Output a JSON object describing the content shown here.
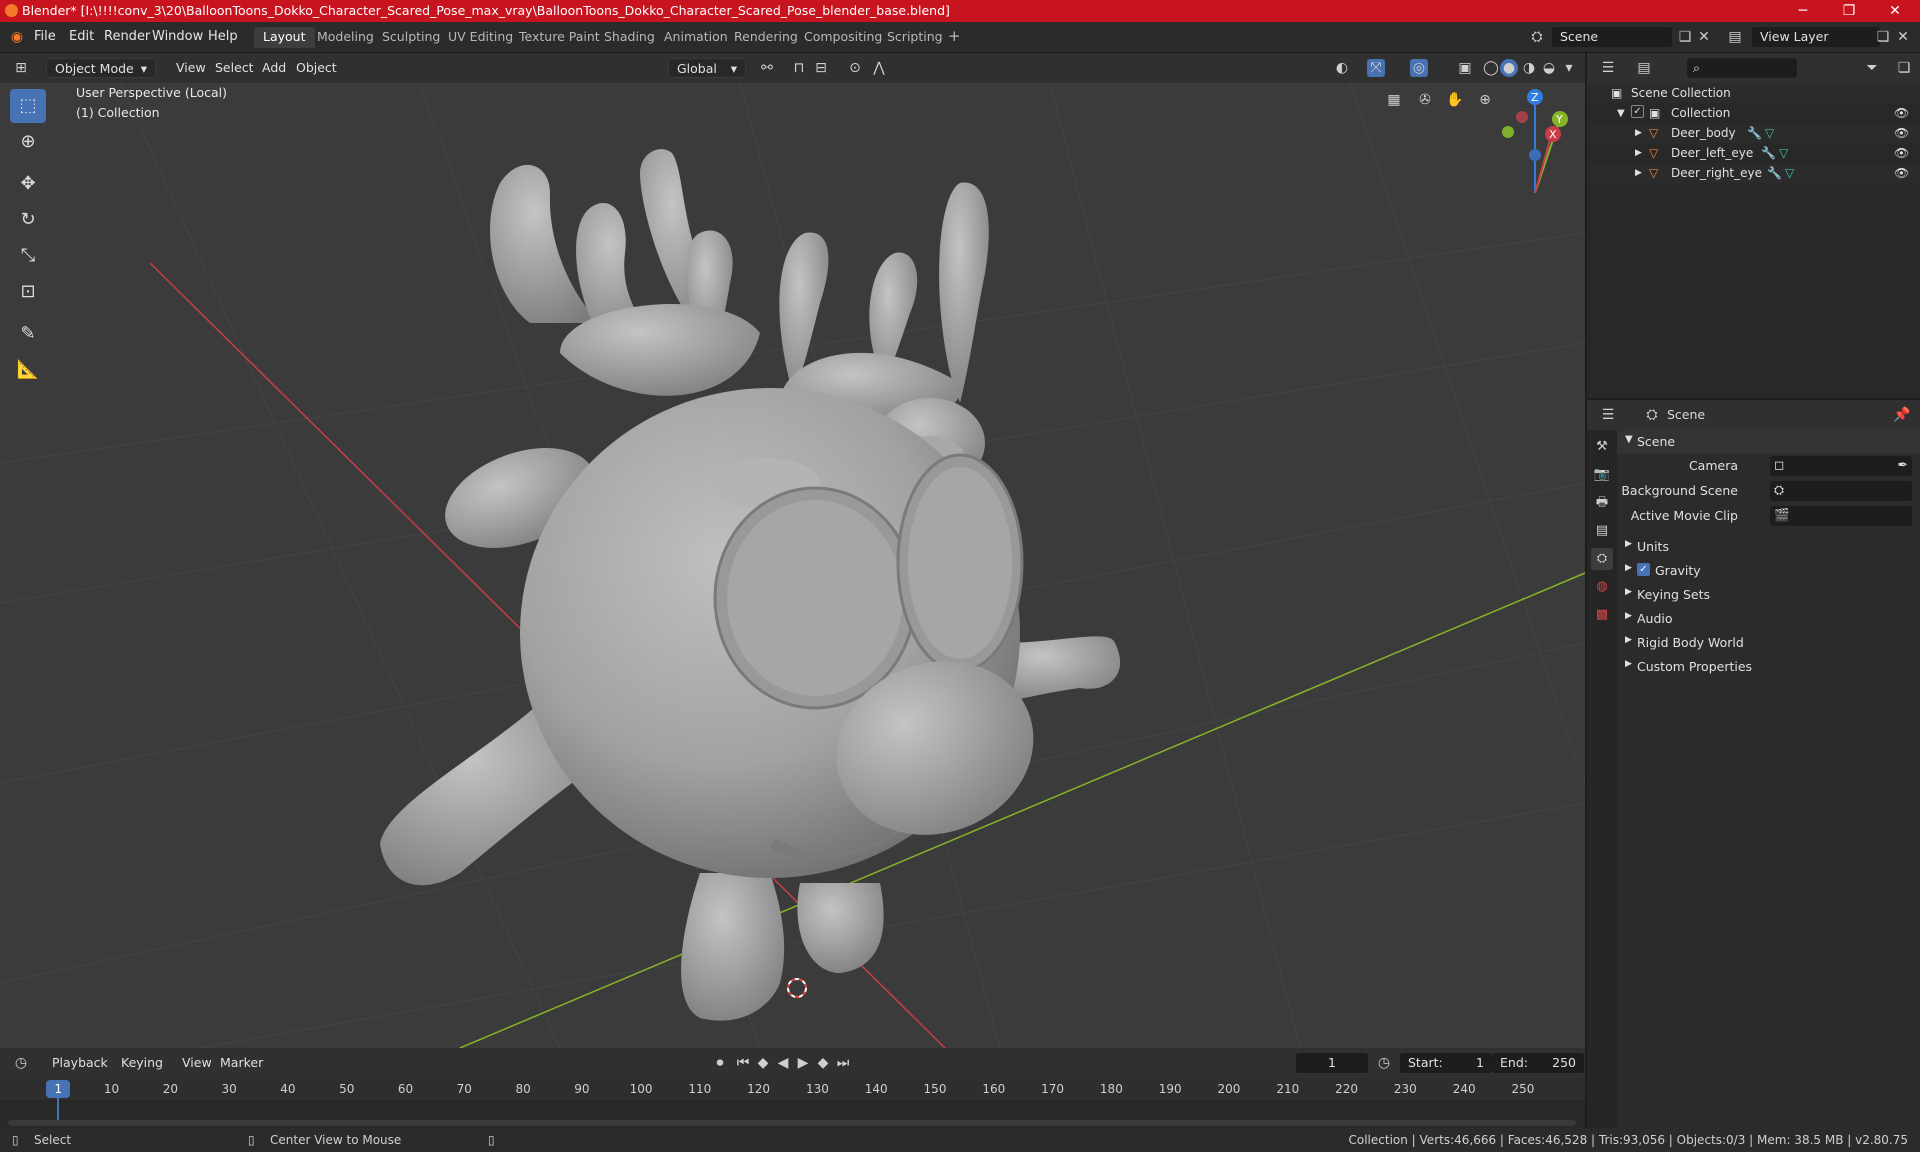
{
  "window": {
    "title": "Blender* [I:\\!!!!conv_3\\20\\BalloonToons_Dokko_Character_Scared_Pose_max_vray\\BalloonToons_Dokko_Character_Scared_Pose_blender_base.blend]",
    "minimize": "─",
    "maximize": "❐",
    "close": "✕"
  },
  "menu": {
    "items": [
      "File",
      "Edit",
      "Render",
      "Window",
      "Help"
    ]
  },
  "workspaces": [
    "Layout",
    "Modeling",
    "Sculpting",
    "UV Editing",
    "Texture Paint",
    "Shading",
    "Animation",
    "Rendering",
    "Compositing",
    "Scripting"
  ],
  "workspace_add": "+",
  "scene_field": "Scene",
  "view_layer_field": "View Layer",
  "viewport_header": {
    "mode": "Object Mode",
    "menus": [
      "View",
      "Select",
      "Add",
      "Object"
    ],
    "orientation": "Global"
  },
  "viewport": {
    "perspective": "User Perspective (Local)",
    "collection": "(1) Collection",
    "gizmo": {
      "z": "Z",
      "y": "Y",
      "x": "X"
    }
  },
  "outliner": {
    "root": "Scene Collection",
    "collection": "Collection",
    "objects": [
      "Deer_body",
      "Deer_left_eye",
      "Deer_right_eye"
    ]
  },
  "properties": {
    "header": "Scene",
    "section": "Scene",
    "fields": [
      {
        "label": "Camera",
        "value": ""
      },
      {
        "label": "Background Scene",
        "value": ""
      },
      {
        "label": "Active Movie Clip",
        "value": ""
      }
    ],
    "panels": [
      "Units",
      "Gravity",
      "Keying Sets",
      "Audio",
      "Rigid Body World",
      "Custom Properties"
    ]
  },
  "timeline": {
    "menus": [
      "Playback",
      "Keying",
      "View",
      "Marker"
    ],
    "current_frame": "1",
    "start_label": "Start:",
    "start": "1",
    "end_label": "End:",
    "end": "250",
    "ticks": [
      "1",
      "10",
      "20",
      "30",
      "40",
      "50",
      "60",
      "70",
      "80",
      "90",
      "100",
      "110",
      "120",
      "130",
      "140",
      "150",
      "160",
      "170",
      "180",
      "190",
      "200",
      "210",
      "220",
      "230",
      "240",
      "250"
    ]
  },
  "status": {
    "select": "Select",
    "center": "Center View to Mouse",
    "stats": "Collection | Verts:46,666 | Faces:46,528 | Tris:93,056 | Objects:0/3 | Mem: 38.5 MB | v2.80.75"
  },
  "colors": {
    "title_bar": "#c8141e",
    "accent": "#4772b3",
    "x_axis": "#c93c46",
    "y_axis": "#86b428",
    "z_axis": "#2f7de0"
  }
}
